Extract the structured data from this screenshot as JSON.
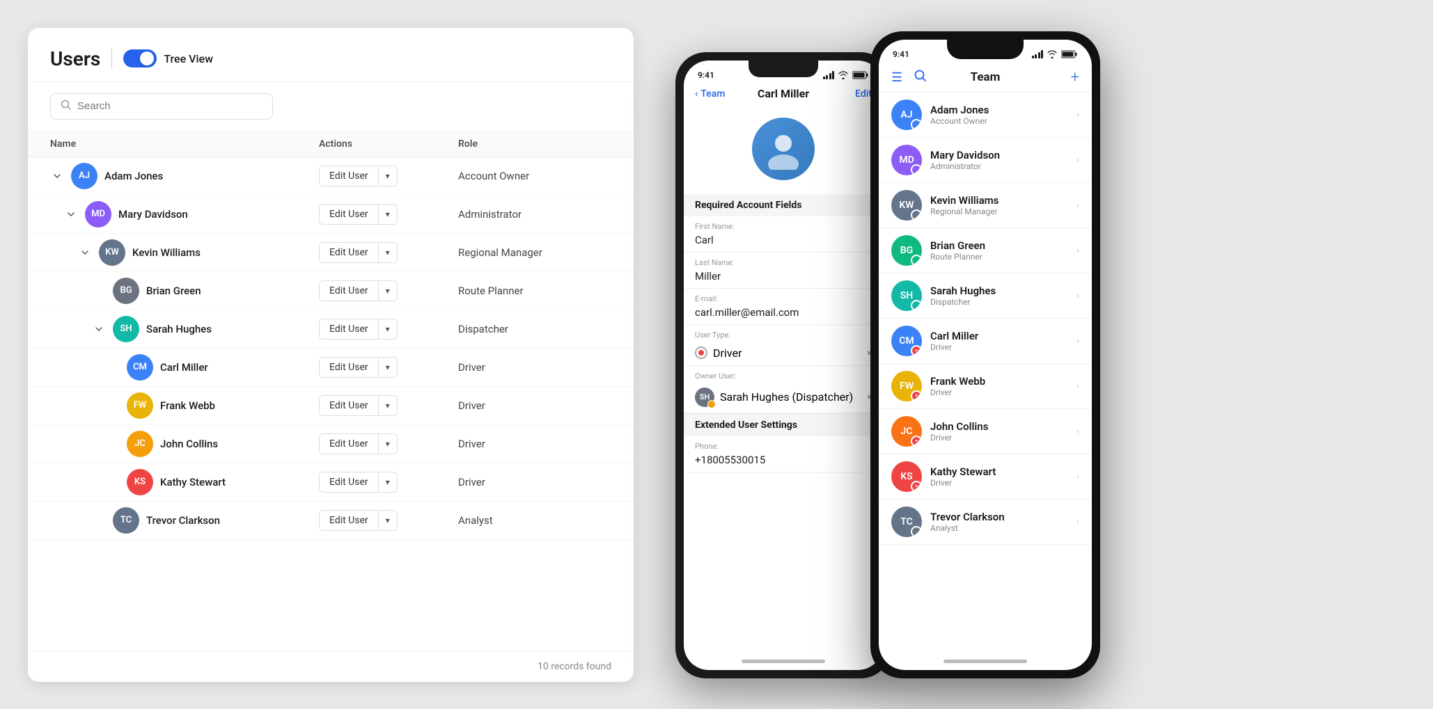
{
  "page": {
    "title": "Users",
    "toggle_label": "Tree View",
    "search_placeholder": "Search",
    "records_count": "10 records found"
  },
  "table": {
    "columns": [
      "Name",
      "Actions",
      "Role"
    ],
    "edit_label": "Edit User",
    "rows": [
      {
        "id": 1,
        "name": "Adam Jones",
        "role": "Account Owner",
        "indent": 0,
        "expandable": true,
        "expanded": true,
        "avatar_color": "bg-blue",
        "initials": "AJ"
      },
      {
        "id": 2,
        "name": "Mary Davidson",
        "role": "Administrator",
        "indent": 1,
        "expandable": true,
        "expanded": true,
        "avatar_color": "bg-purple",
        "initials": "MD"
      },
      {
        "id": 3,
        "name": "Kevin Williams",
        "role": "Regional Manager",
        "indent": 2,
        "expandable": true,
        "expanded": true,
        "avatar_color": "bg-slate",
        "initials": "KW"
      },
      {
        "id": 4,
        "name": "Brian Green",
        "role": "Route Planner",
        "indent": 3,
        "expandable": false,
        "expanded": false,
        "avatar_color": "bg-gray",
        "initials": "BG"
      },
      {
        "id": 5,
        "name": "Sarah Hughes",
        "role": "Dispatcher",
        "indent": 3,
        "expandable": true,
        "expanded": true,
        "avatar_color": "bg-teal",
        "initials": "SH"
      },
      {
        "id": 6,
        "name": "Carl Miller",
        "role": "Driver",
        "indent": 4,
        "expandable": false,
        "expanded": false,
        "avatar_color": "bg-blue",
        "initials": "CM"
      },
      {
        "id": 7,
        "name": "Frank Webb",
        "role": "Driver",
        "indent": 4,
        "expandable": false,
        "expanded": false,
        "avatar_color": "bg-yellow",
        "initials": "FW"
      },
      {
        "id": 8,
        "name": "John Collins",
        "role": "Driver",
        "indent": 4,
        "expandable": false,
        "expanded": false,
        "avatar_color": "bg-orange",
        "initials": "JC"
      },
      {
        "id": 9,
        "name": "Kathy Stewart",
        "role": "Driver",
        "indent": 4,
        "expandable": false,
        "expanded": false,
        "avatar_color": "bg-red",
        "initials": "KS"
      },
      {
        "id": 10,
        "name": "Trevor Clarkson",
        "role": "Analyst",
        "indent": 3,
        "expandable": false,
        "expanded": false,
        "avatar_color": "bg-slate",
        "initials": "TC"
      }
    ]
  },
  "phone_back": {
    "status_time": "9:41",
    "nav_back": "Team",
    "nav_title": "Carl Miller",
    "nav_edit": "Edit",
    "section_required": "Required Account Fields",
    "field_first_name_label": "First Name:",
    "field_first_name_value": "Carl",
    "field_last_name_label": "Last Name:",
    "field_last_name_value": "Miller",
    "field_email_label": "E-mail:",
    "field_email_value": "carl.miller@email.com",
    "field_user_type_label": "User Type:",
    "field_user_type_value": "Driver",
    "field_owner_label": "Owner User:",
    "field_owner_value": "Sarah Hughes (Dispatcher)",
    "section_extended": "Extended User Settings",
    "field_phone_label": "Phone:"
  },
  "phone_front": {
    "status_time": "9:41",
    "nav_title": "Team",
    "team_members": [
      {
        "name": "Adam Jones",
        "role": "Account Owner",
        "badge_color": "#3b82f6",
        "initials": "AJ",
        "avatar_color": "#3b82f6"
      },
      {
        "name": "Mary Davidson",
        "role": "Administrator",
        "badge_color": "#8b5cf6",
        "initials": "MD",
        "avatar_color": "#8b5cf6"
      },
      {
        "name": "Kevin Williams",
        "role": "Regional Manager",
        "badge_color": "#64748b",
        "initials": "KW",
        "avatar_color": "#64748b"
      },
      {
        "name": "Brian Green",
        "role": "Route Planner",
        "badge_color": "#10b981",
        "initials": "BG",
        "avatar_color": "#10b981"
      },
      {
        "name": "Sarah Hughes",
        "role": "Dispatcher",
        "badge_color": "#14b8a6",
        "initials": "SH",
        "avatar_color": "#14b8a6"
      },
      {
        "name": "Carl Miller",
        "role": "Driver",
        "badge_color": "#ef4444",
        "initials": "CM",
        "avatar_color": "#3b82f6"
      },
      {
        "name": "Frank Webb",
        "role": "Driver",
        "badge_color": "#ef4444",
        "initials": "FW",
        "avatar_color": "#eab308"
      },
      {
        "name": "John Collins",
        "role": "Driver",
        "badge_color": "#ef4444",
        "initials": "JC",
        "avatar_color": "#f97316"
      },
      {
        "name": "Kathy Stewart",
        "role": "Driver",
        "badge_color": "#ef4444",
        "initials": "KS",
        "avatar_color": "#ef4444"
      },
      {
        "name": "Trevor Clarkson",
        "role": "Analyst",
        "badge_color": "#6b7280",
        "initials": "TC",
        "avatar_color": "#64748b"
      }
    ]
  }
}
